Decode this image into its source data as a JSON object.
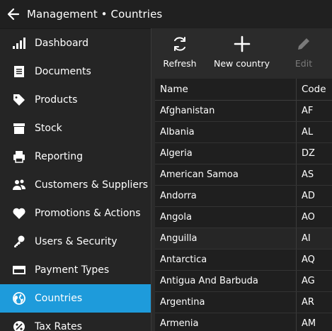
{
  "window": {
    "title": "Management • Countries"
  },
  "sidebar": {
    "items": [
      {
        "label": "Dashboard",
        "icon": "bar-chart-icon",
        "active": false
      },
      {
        "label": "Documents",
        "icon": "document-icon",
        "active": false
      },
      {
        "label": "Products",
        "icon": "tag-icon",
        "active": false
      },
      {
        "label": "Stock",
        "icon": "box-icon",
        "active": false
      },
      {
        "label": "Reporting",
        "icon": "printer-icon",
        "active": false
      },
      {
        "label": "Customers & Suppliers",
        "icon": "people-icon",
        "active": false
      },
      {
        "label": "Promotions & Actions",
        "icon": "heart-icon",
        "active": false
      },
      {
        "label": "Users & Security",
        "icon": "key-icon",
        "active": false
      },
      {
        "label": "Payment Types",
        "icon": "credit-card-icon",
        "active": false
      },
      {
        "label": "Countries",
        "icon": "globe-icon",
        "active": true
      },
      {
        "label": "Tax Rates",
        "icon": "percent-icon",
        "active": false
      }
    ]
  },
  "toolbar": {
    "refresh_label": "Refresh",
    "new_label": "New country",
    "edit_label": "Edit"
  },
  "grid": {
    "columns": [
      "Name",
      "Code"
    ],
    "rows": [
      [
        "Afghanistan",
        "AF"
      ],
      [
        "Albania",
        "AL"
      ],
      [
        "Algeria",
        "DZ"
      ],
      [
        "American Samoa",
        "AS"
      ],
      [
        "Andorra",
        "AD"
      ],
      [
        "Angola",
        "AO"
      ],
      [
        "Anguilla",
        "AI"
      ],
      [
        "Antarctica",
        "AQ"
      ],
      [
        "Antigua And Barbuda",
        "AG"
      ],
      [
        "Argentina",
        "AR"
      ],
      [
        "Armenia",
        "AM"
      ]
    ]
  },
  "colors": {
    "accent": "#1e9bdb",
    "background": "#2b2b2b",
    "sidebar": "#252525",
    "grid": "#1f1f1f"
  }
}
